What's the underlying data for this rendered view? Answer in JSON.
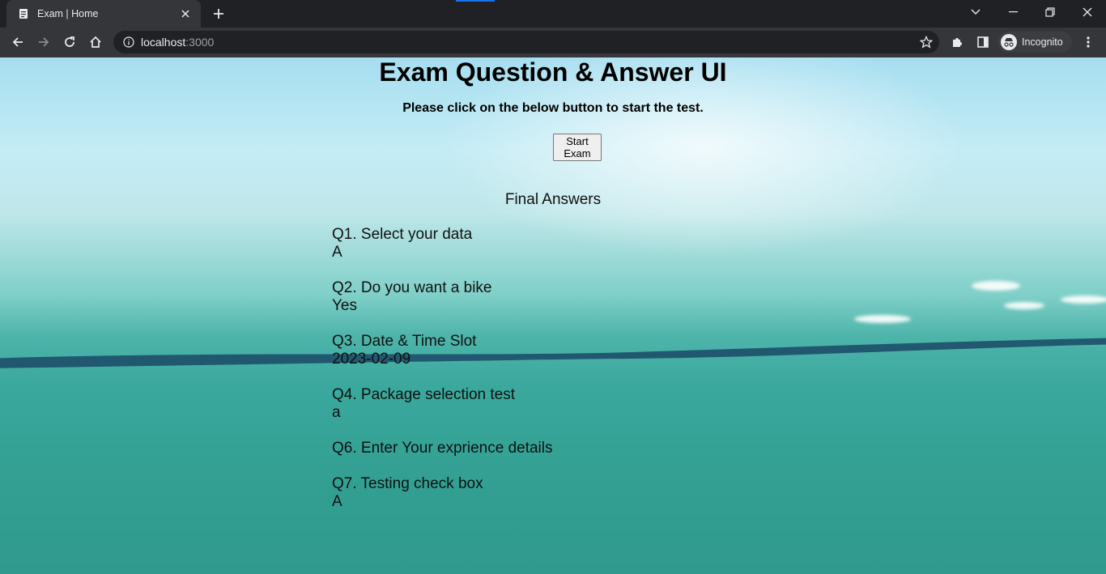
{
  "browser": {
    "tab_title": "Exam | Home",
    "url_host": "localhost",
    "url_port": ":3000",
    "profile_label": "Incognito"
  },
  "page": {
    "title": "Exam Question & Answer UI",
    "instruction": "Please click on the below button to start the test.",
    "start_button": "Start Exam",
    "answers_heading": "Final Answers",
    "answers": [
      {
        "question": "Q1. Select your data",
        "answer": "A"
      },
      {
        "question": "Q2. Do you want a bike",
        "answer": "Yes"
      },
      {
        "question": "Q3. Date & Time Slot",
        "answer": "2023-02-09"
      },
      {
        "question": "Q4. Package selection test",
        "answer": "a"
      },
      {
        "question": "Q6. Enter Your exprience details",
        "answer": ""
      },
      {
        "question": "Q7. Testing check box",
        "answer": "A"
      }
    ]
  },
  "colors": {
    "chrome_dark": "#202124",
    "chrome_toolbar": "#35363a",
    "text": "#000000"
  }
}
